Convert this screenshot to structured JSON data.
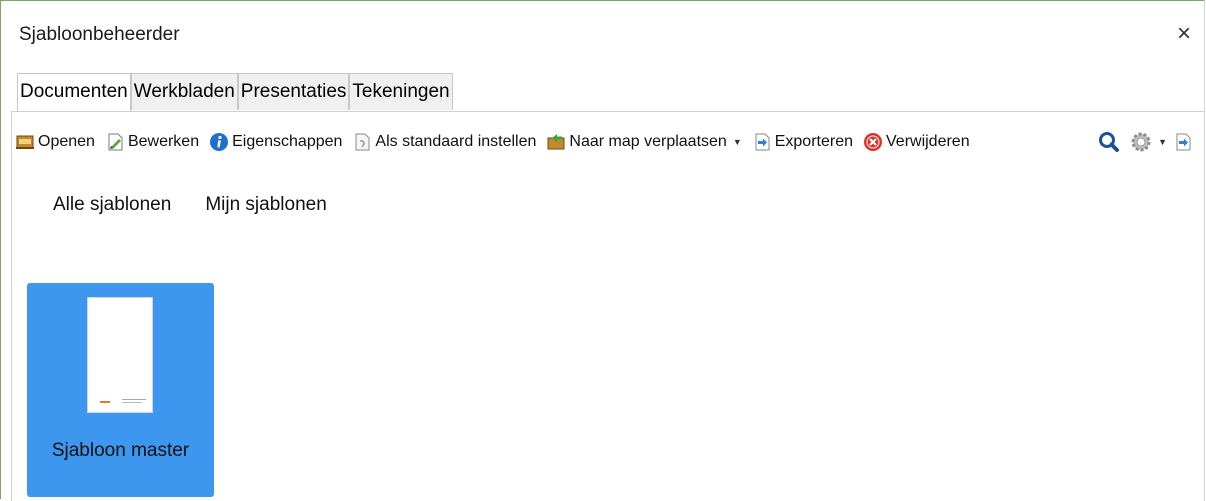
{
  "window": {
    "title": "Sjabloonbeheerder",
    "close_symbol": "×"
  },
  "tabs": [
    {
      "label": "Documenten",
      "active": true
    },
    {
      "label": "Werkbladen",
      "active": false
    },
    {
      "label": "Presentaties",
      "active": false
    },
    {
      "label": "Tekeningen",
      "active": false
    }
  ],
  "toolbar": {
    "open": {
      "label": "Openen",
      "icon": "folder-open-icon"
    },
    "edit": {
      "label": "Bewerken",
      "icon": "edit-document-icon"
    },
    "properties": {
      "label": "Eigenschappen",
      "icon": "info-icon"
    },
    "set_default": {
      "label": "Als standaard instellen",
      "icon": "set-default-icon"
    },
    "move": {
      "label": "Naar map verplaatsen",
      "icon": "move-to-folder-icon"
    },
    "export": {
      "label": "Exporteren",
      "icon": "export-icon"
    },
    "delete": {
      "label": "Verwijderen",
      "icon": "delete-icon"
    },
    "right_icons": [
      "search-icon",
      "settings-gear-icon",
      "import-icon"
    ]
  },
  "filters": [
    {
      "label": "Alle sjablonen"
    },
    {
      "label": "Mijn sjablonen"
    }
  ],
  "templates": [
    {
      "label": "Sjabloon master",
      "selected": true
    }
  ],
  "colors": {
    "selection": "#3d97ee",
    "info_blue": "#1f6fd1",
    "delete_red": "#e0302a"
  }
}
